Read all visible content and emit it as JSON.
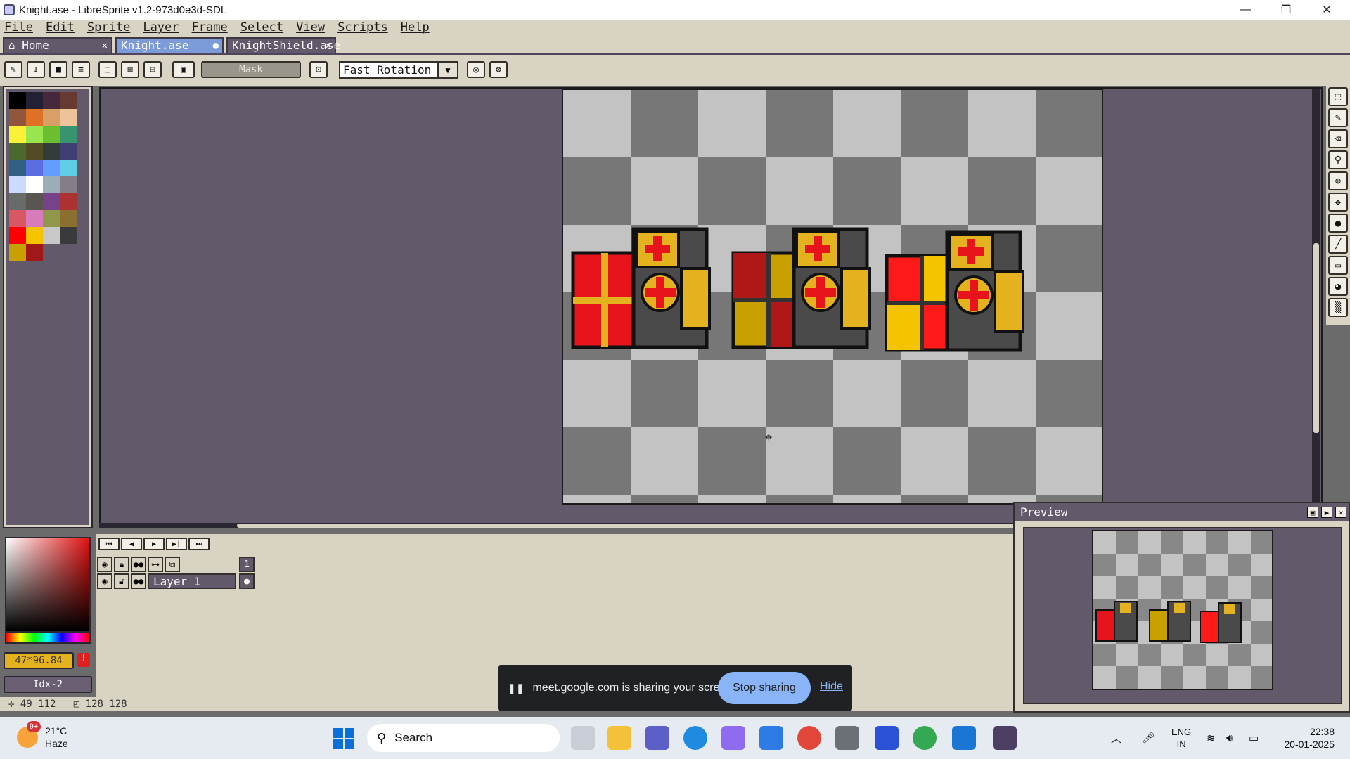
{
  "window": {
    "title": "Knight.ase - LibreSprite v1.2-973d0e3d-SDL",
    "minimize": "—",
    "maximize": "❐",
    "close": "✕"
  },
  "menu": [
    "File",
    "Edit",
    "Sprite",
    "Layer",
    "Frame",
    "Select",
    "View",
    "Scripts",
    "Help"
  ],
  "tabs": [
    {
      "label": "Home",
      "close": "✕"
    },
    {
      "label": "Knight.ase",
      "close": "●"
    },
    {
      "label": "KnightShield.ase",
      "close": "✕"
    }
  ],
  "toolbar": {
    "mask_label": "Mask",
    "rotation_algorithm": "Fast Rotation"
  },
  "palette": {
    "colors": [
      "#000000",
      "#222034",
      "#45283c",
      "#663931",
      "#8f563b",
      "#df7126",
      "#d9a066",
      "#eec39a",
      "#fbf236",
      "#99e550",
      "#6abe30",
      "#37946e",
      "#4b692f",
      "#524b24",
      "#323c39",
      "#3f3f74",
      "#306082",
      "#5b6ee1",
      "#639bff",
      "#5fcde4",
      "#cbdbfc",
      "#ffffff",
      "#9badb7",
      "#847e87",
      "#696a6a",
      "#595652",
      "#76428a",
      "#ac3232",
      "#d95763",
      "#d77bba",
      "#8f974a",
      "#8a6f30",
      "#ff0000",
      "#f5c400",
      "#c8c8c8",
      "#3a3a3a",
      "#c8a000",
      "#a01818"
    ]
  },
  "color_bar": {
    "hex_value": "47*96.84",
    "index_value": "Idx-2"
  },
  "timeline": {
    "header_frame": "1",
    "layers": [
      {
        "name": "Layer 1"
      }
    ]
  },
  "preview": {
    "title": "Preview"
  },
  "status": {
    "cursor_pos": "49 112",
    "sprite_size": "128 128"
  },
  "screen_share": {
    "message": "meet.google.com is sharing your screen.",
    "stop_label": "Stop sharing",
    "hide_label": "Hide"
  },
  "taskbar": {
    "weather_temp": "21°C",
    "weather_desc": "Haze",
    "weather_badge": "9+",
    "search_placeholder": "Search",
    "language_top": "ENG",
    "language_bottom": "IN",
    "time": "22:38",
    "date": "20-01-2025"
  },
  "colors": {
    "ui_beige": "#d9d3c3",
    "ui_purple": "#625a6b",
    "tab_active": "#7c9bd8",
    "knight_red": "#e8141c",
    "knight_gold": "#e3b21e",
    "knight_armor": "#4a4a4a"
  }
}
